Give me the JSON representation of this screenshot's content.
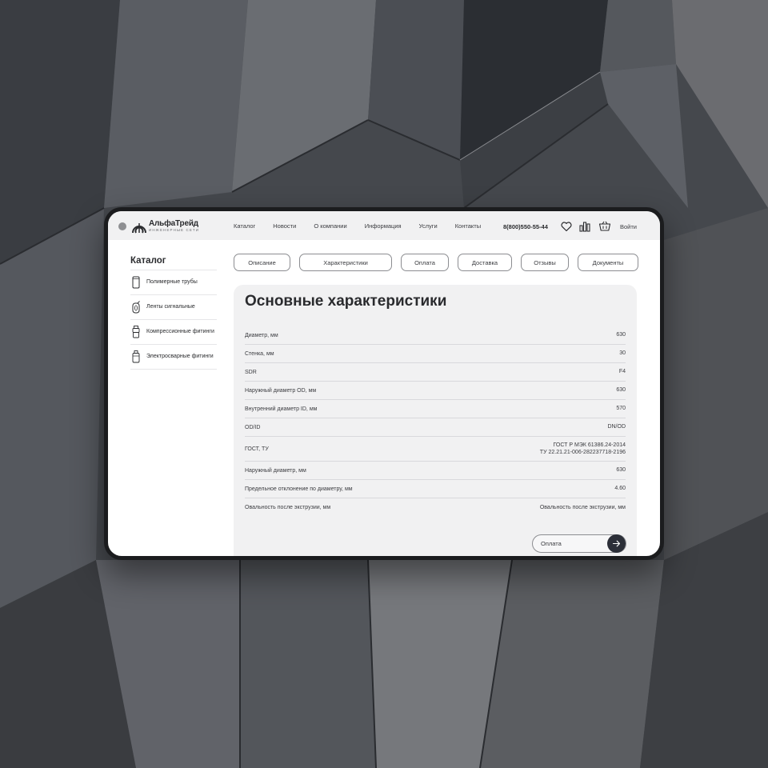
{
  "header": {
    "logo_name": "АльфаТрейд",
    "logo_sub": "ИНЖЕНЕРНЫЕ СЕТИ",
    "nav": [
      "Каталог",
      "Новости",
      "О компании",
      "Информация",
      "Услуги",
      "Контакты"
    ],
    "phone": "8(800)550-55-44",
    "login": "Войти",
    "icons": [
      "heart-icon",
      "compare-icon",
      "cart-icon"
    ]
  },
  "sidebar": {
    "title": "Каталог",
    "items": [
      {
        "label": "Полимерные трубы",
        "icon": "pipe-icon"
      },
      {
        "label": "Ленты сигнальные",
        "icon": "tape-roll-icon"
      },
      {
        "label": "Компрессионные фитинги",
        "icon": "compression-fitting-icon"
      },
      {
        "label": "Электросварные фитинги",
        "icon": "electrofusion-fitting-icon"
      }
    ]
  },
  "tabs": [
    "Описание",
    "Характеристики",
    "Оплата",
    "Доставка",
    "Отзывы",
    "Документы"
  ],
  "main": {
    "title": "Основные характеристики",
    "specs": [
      {
        "name": "Диаметр, мм",
        "value": "630"
      },
      {
        "name": "Стенка, мм",
        "value": "30"
      },
      {
        "name": "SDR",
        "value": "F4"
      },
      {
        "name": "Наружный диаметр OD, мм",
        "value": "630"
      },
      {
        "name": "Внутренний диаметр ID, мм",
        "value": "570"
      },
      {
        "name": "OD/ID",
        "value": "DN/OD"
      },
      {
        "name": "ГОСТ, ТУ",
        "value": "ГОСТ Р МЭК 61386.24-2014",
        "value2": "ТУ 22.21.21-006-282237718-2196"
      },
      {
        "name": "Наружный диаметр, мм",
        "value": "630"
      },
      {
        "name": "Предельное отклонение по диаметру, мм",
        "value": "4.60"
      },
      {
        "name": "Овальность после экструзии, мм",
        "value": "Овальность после экструзии, мм"
      }
    ],
    "pay_button": "Оплата"
  },
  "colors": {
    "accent_dark": "#2c2f38",
    "header_bg": "#f1f1f2",
    "card_bg": "#f1f1f2",
    "frame": "#1b1c1e"
  }
}
